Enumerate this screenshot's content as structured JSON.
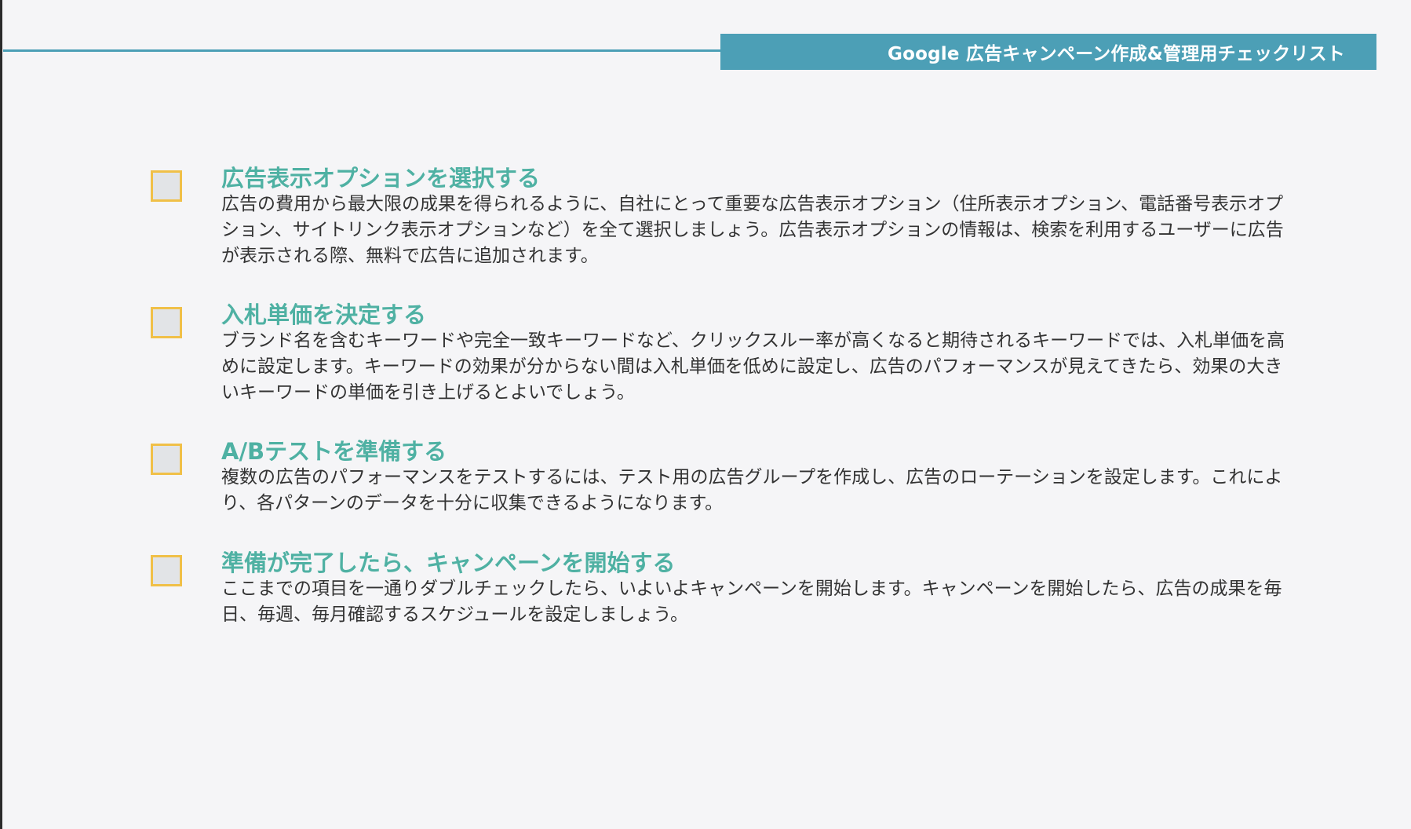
{
  "header": {
    "title": "Google 広告キャンペーン作成&管理用チェックリスト"
  },
  "colors": {
    "accent": "#4c9fb6",
    "title_green": "#4fb1a3",
    "checkbox_border": "#f0c048",
    "checkbox_fill": "#e2e4e7",
    "text": "#333333",
    "background": "#f5f5f7"
  },
  "checklist": {
    "items": [
      {
        "title": "広告表示オプションを選択する",
        "description": "広告の費用から最大限の成果を得られるように、自社にとって重要な広告表示オプション（住所表示オプション、電話番号表示オプション、サイトリンク表示オプションなど）を全て選択しましょう。広告表示オプションの情報は、検索を利用するユーザーに広告が表示される際、無料で広告に追加されます。",
        "checked": false
      },
      {
        "title": "入札単価を決定する",
        "description": "ブランド名を含むキーワードや完全一致キーワードなど、クリックスルー率が高くなると期待されるキーワードでは、入札単価を高めに設定します。キーワードの効果が分からない間は入札単価を低めに設定し、広告のパフォーマンスが見えてきたら、効果の大きいキーワードの単価を引き上げるとよいでしょう。",
        "checked": false
      },
      {
        "title": "A/Bテストを準備する",
        "description": "複数の広告のパフォーマンスをテストするには、テスト用の広告グループを作成し、広告のローテーションを設定します。これにより、各パターンのデータを十分に収集できるようになります。",
        "checked": false
      },
      {
        "title": "準備が完了したら、キャンペーンを開始する",
        "description": "ここまでの項目を一通りダブルチェックしたら、いよいよキャンペーンを開始します。キャンペーンを開始したら、広告の成果を毎日、毎週、毎月確認するスケジュールを設定しましょう。",
        "checked": false
      }
    ]
  }
}
